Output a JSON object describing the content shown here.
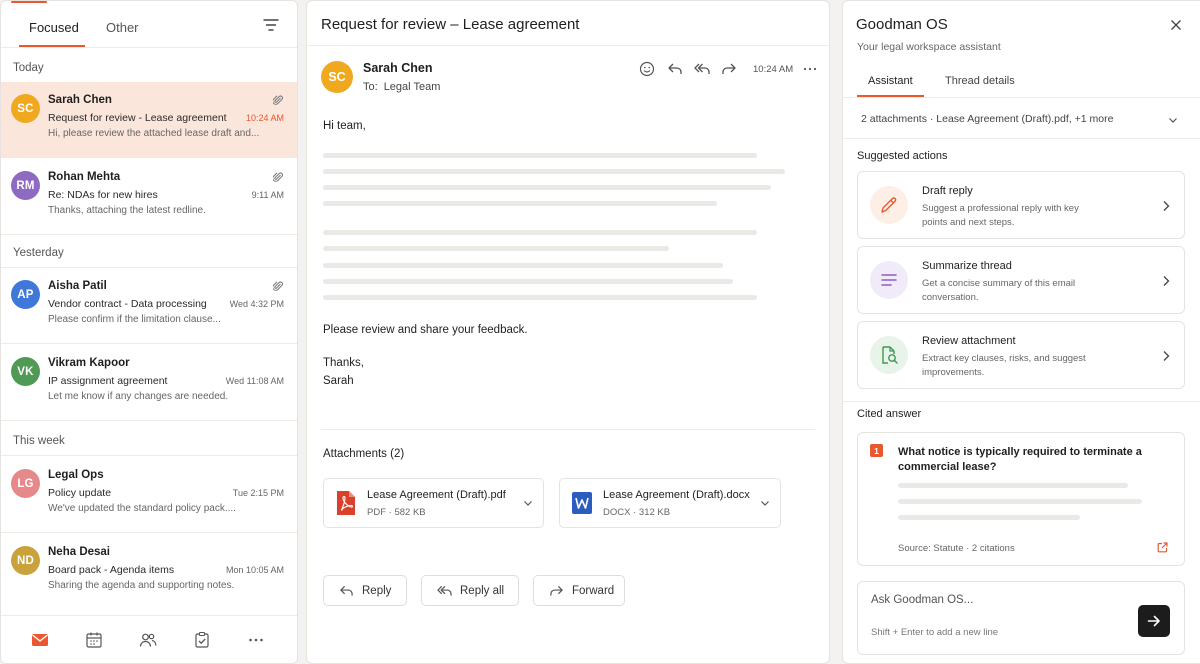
{
  "colors": {
    "accent": "#e9582e",
    "selected_bg": "#fbe6dc"
  },
  "inbox": {
    "tabs": [
      {
        "label": "Focused",
        "active": true
      },
      {
        "label": "Other",
        "active": false
      }
    ],
    "groups": {
      "today": "Today",
      "yesterday": "Yesterday",
      "this_week": "This week"
    },
    "messages": [
      {
        "initials": "SC",
        "avatar_color": "#f0a91e",
        "sender": "Sarah Chen",
        "subject": "Request for review - Lease agreement",
        "preview": "Hi, please review the attached lease draft and...",
        "time": "10:24 AM",
        "has_attachment": true,
        "selected": true
      },
      {
        "initials": "RM",
        "avatar_color": "#8e6ac0",
        "sender": "Rohan Mehta",
        "subject": "Re: NDAs for new hires",
        "preview": "Thanks, attaching the latest redline.",
        "time": "9:11 AM",
        "has_attachment": true,
        "selected": false
      },
      {
        "initials": "AP",
        "avatar_color": "#3f78d9",
        "sender": "Aisha Patil",
        "subject": "Vendor contract - Data processing",
        "preview": "Please confirm if the limitation clause...",
        "time": "Wed 4:32 PM",
        "has_attachment": true,
        "selected": false
      },
      {
        "initials": "VK",
        "avatar_color": "#4f9a54",
        "sender": "Vikram Kapoor",
        "subject": "IP assignment agreement",
        "preview": "Let me know if any changes are needed.",
        "time": "Wed 11:08 AM",
        "has_attachment": false,
        "selected": false
      },
      {
        "initials": "LG",
        "avatar_color": "#e6898a",
        "sender": "Legal Ops",
        "subject": "Policy update",
        "preview": "We've updated the standard policy pack....",
        "time": "Tue 2:15 PM",
        "has_attachment": false,
        "selected": false
      },
      {
        "initials": "ND",
        "avatar_color": "#c9a23c",
        "sender": "Neha Desai",
        "subject": "Board pack - Agenda items",
        "preview": "Sharing the agenda and supporting notes.",
        "time": "Mon 10:05 AM",
        "has_attachment": false,
        "selected": false
      }
    ],
    "bottom_nav": [
      "mail-icon",
      "calendar-icon",
      "people-icon",
      "tasks-icon",
      "more-icon"
    ]
  },
  "email": {
    "title": "Request for review – Lease agreement",
    "from_initials": "SC",
    "from": "Sarah Chen",
    "to_label": "To:",
    "to": "Legal Team",
    "time": "10:24 AM",
    "greeting": "Hi team,",
    "request": "Please review and share your feedback.",
    "signoff": "Thanks,",
    "signature": "Sarah",
    "attachments_title": "Attachments (2)",
    "attachments": [
      {
        "name": "Lease Agreement (Draft).pdf",
        "type": "PDF",
        "size": "582 KB",
        "icon": "pdf-icon"
      },
      {
        "name": "Lease Agreement (Draft).docx",
        "type": "DOCX",
        "size": "312 KB",
        "icon": "word-icon"
      }
    ],
    "actions": {
      "reply": "Reply",
      "reply_all": "Reply all",
      "forward": "Forward"
    }
  },
  "assistant": {
    "title": "Goodman OS",
    "subtitle": "Your legal workspace assistant",
    "tabs": [
      {
        "label": "Assistant",
        "active": true
      },
      {
        "label": "Thread details",
        "active": false
      }
    ],
    "attachments_summary": "2 attachments · Lease Agreement (Draft).pdf, +1 more",
    "suggested_title": "Suggested actions",
    "suggestions": [
      {
        "title": "Draft reply",
        "description": "Suggest a professional reply with key points and next steps.",
        "icon": "pencil-icon",
        "tint": "#fdeee6",
        "color": "#e9582e"
      },
      {
        "title": "Summarize thread",
        "description": "Get a concise summary of this email conversation.",
        "icon": "lines-icon",
        "tint": "#f1eaf8",
        "color": "#8e5cc4"
      },
      {
        "title": "Review attachment",
        "description": "Extract key clauses, risks, and suggest improvements.",
        "icon": "doc-search-icon",
        "tint": "#e8f3ea",
        "color": "#3d9a52"
      }
    ],
    "cited_title": "Cited answer",
    "cited": {
      "number": "1",
      "question": "What notice is typically required to terminate a commercial lease?",
      "source": "Source: Statute · 2 citations"
    },
    "input_placeholder": "Ask Goodman OS...",
    "input_hint": "Shift + Enter to add a new line"
  }
}
